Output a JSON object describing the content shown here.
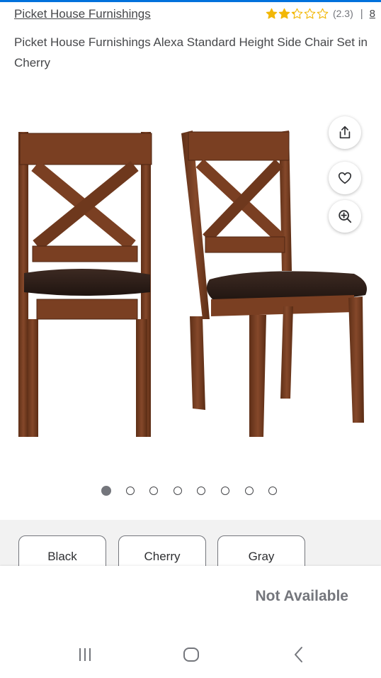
{
  "colors": {
    "accent": "#0071dc",
    "star": "#f2b705",
    "text_gray": "#74767c",
    "text_dark": "#2e2f32",
    "section_bg": "#f2f2f2"
  },
  "header": {
    "brand": "Picket House Furnishings",
    "rating_value": 2.3,
    "rating_text": "(2.3)",
    "separator": "|",
    "review_count": "8"
  },
  "product": {
    "title": "Picket House Furnishings Alexa Standard Height Side Chair Set in Cherry"
  },
  "gallery": {
    "image_count": 8,
    "active_index": 0,
    "actions": [
      {
        "icon": "share-icon"
      },
      {
        "icon": "heart-icon"
      },
      {
        "icon": "zoom-in-icon"
      }
    ]
  },
  "variants": {
    "options": [
      "Black",
      "Cherry",
      "Gray"
    ]
  },
  "availability": {
    "text": "Not Available"
  },
  "system_nav": {
    "buttons": [
      {
        "icon": "recent-apps-icon"
      },
      {
        "icon": "home-icon"
      },
      {
        "icon": "back-icon"
      }
    ]
  }
}
